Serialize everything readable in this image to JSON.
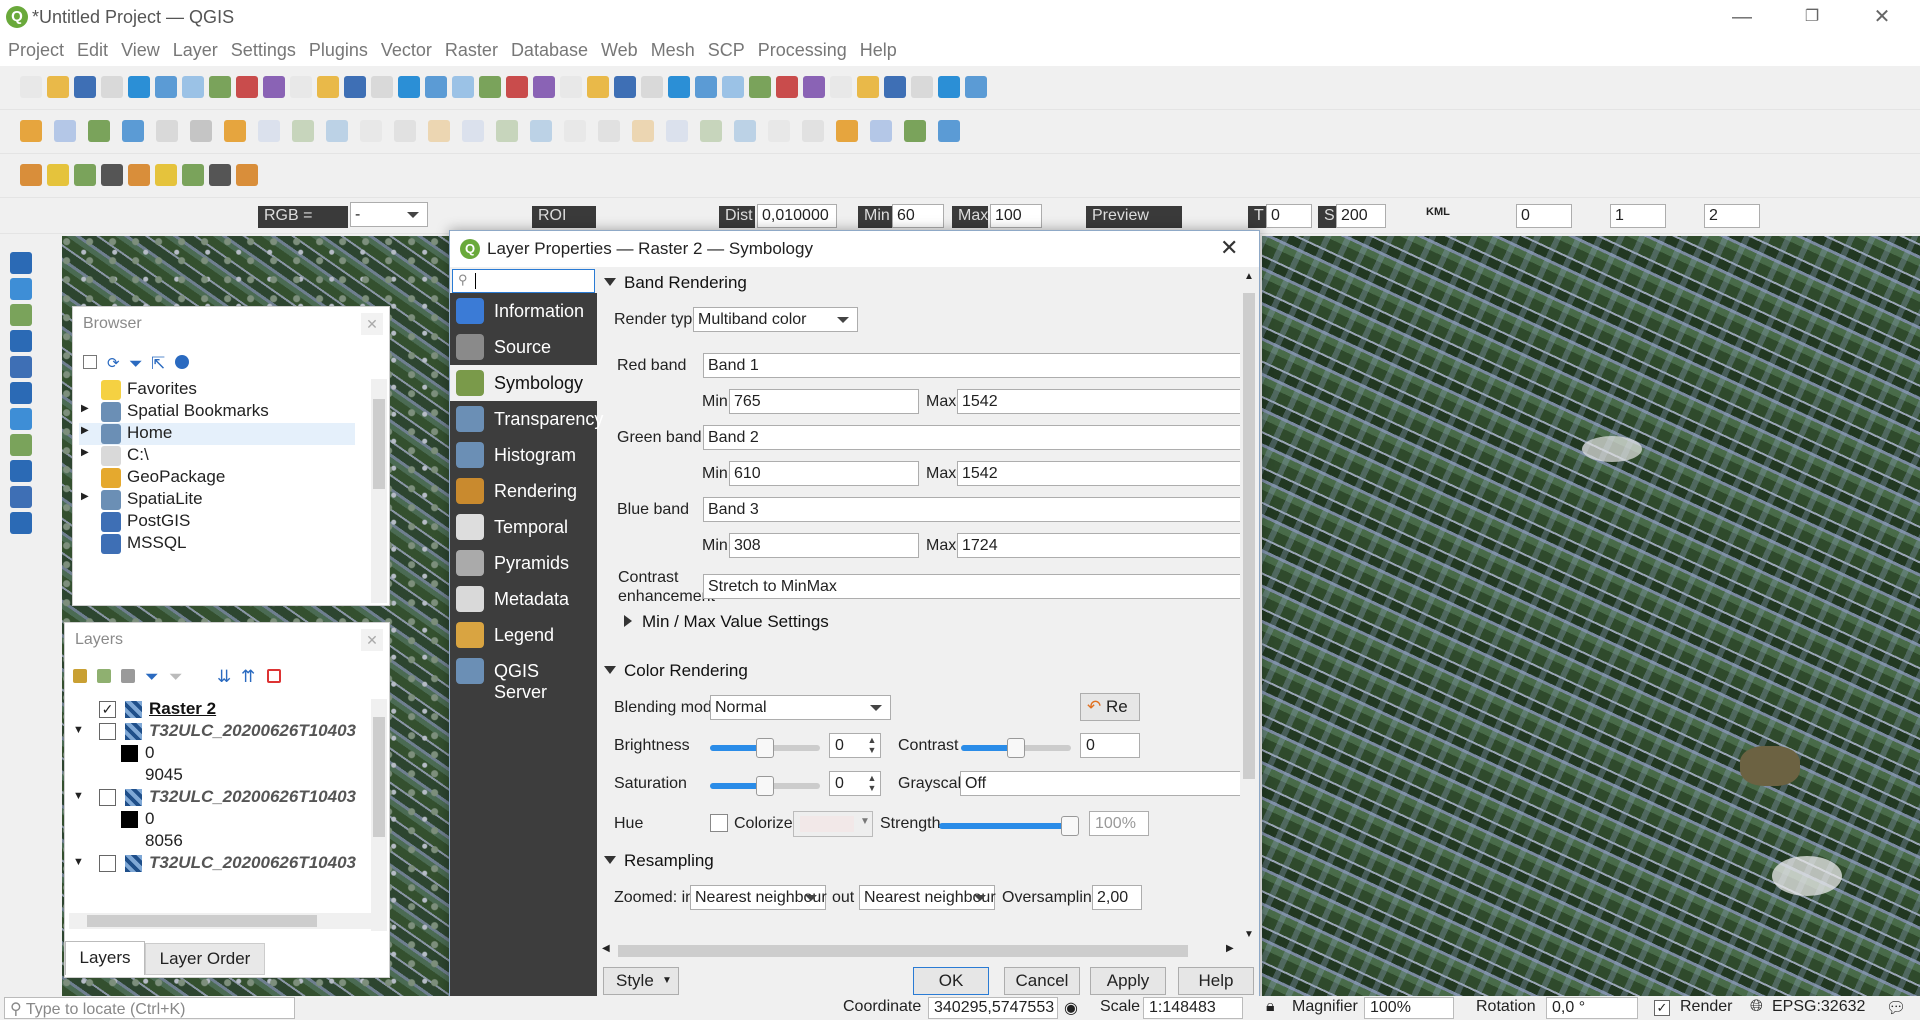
{
  "window": {
    "title": "*Untitled Project — QGIS",
    "logo": "Q"
  },
  "menu": [
    "Project",
    "Edit",
    "View",
    "Layer",
    "Settings",
    "Plugins",
    "Vector",
    "Raster",
    "Database",
    "Web",
    "Mesh",
    "SCP",
    "Processing",
    "Help"
  ],
  "scp_toolbar": {
    "rgb_label": "RGB =",
    "rgb_value": "-",
    "roi_label": "ROI",
    "dist_label": "Dist",
    "dist_value": "0,010000",
    "min_label": "Min",
    "min_value": "60",
    "max_label": "Max",
    "max_value": "100",
    "preview_label": "Preview",
    "t_label": "T",
    "t_value": "0",
    "s_label": "S",
    "s_value": "200",
    "kml_label": "KML",
    "band_a": "0",
    "band_b": "1",
    "band_c": "2"
  },
  "browser": {
    "title": "Browser",
    "items": [
      {
        "label": "Favorites",
        "icon": "star-icon",
        "expand": ""
      },
      {
        "label": "Spatial Bookmarks",
        "icon": "bookmark-icon",
        "expand": "▶"
      },
      {
        "label": "Home",
        "icon": "home-folder-icon",
        "expand": "▶"
      },
      {
        "label": "C:\\",
        "icon": "folder-icon",
        "expand": "▶"
      },
      {
        "label": "GeoPackage",
        "icon": "geopackage-icon",
        "expand": ""
      },
      {
        "label": "SpatiaLite",
        "icon": "spatialite-icon",
        "expand": "▶"
      },
      {
        "label": "PostGIS",
        "icon": "postgis-icon",
        "expand": ""
      },
      {
        "label": "MSSQL",
        "icon": "mssql-icon",
        "expand": ""
      }
    ]
  },
  "layers": {
    "title": "Layers",
    "items": [
      {
        "label": "Raster 2",
        "checked": true,
        "bold": true
      },
      {
        "label": "T32ULC_20200626T10403",
        "checked": false,
        "bold": false
      },
      {
        "label": "0",
        "legend": true
      },
      {
        "label": "9045",
        "legend": false
      },
      {
        "label": "T32ULC_20200626T10403",
        "checked": false,
        "bold": false
      },
      {
        "label": "0",
        "legend": true
      },
      {
        "label": "8056",
        "legend": false
      },
      {
        "label": "T32ULC_20200626T10403",
        "checked": false,
        "bold": false
      }
    ],
    "tabs": [
      "Layers",
      "Layer Order"
    ]
  },
  "dialog": {
    "title": "Layer Properties — Raster 2 — Symbology",
    "search_value": "",
    "nav": [
      {
        "label": "Information",
        "icon": "information-icon",
        "color": "#3b7bd6"
      },
      {
        "label": "Source",
        "icon": "source-icon",
        "color": "#8a8a8a"
      },
      {
        "label": "Symbology",
        "icon": "symbology-icon",
        "color": "#7a9a4a"
      },
      {
        "label": "Transparency",
        "icon": "transparency-icon",
        "color": "#6b8fb5"
      },
      {
        "label": "Histogram",
        "icon": "histogram-icon",
        "color": "#6b8fb5"
      },
      {
        "label": "Rendering",
        "icon": "rendering-icon",
        "color": "#c98a2e"
      },
      {
        "label": "Temporal",
        "icon": "temporal-icon",
        "color": "#dddddd"
      },
      {
        "label": "Pyramids",
        "icon": "pyramids-icon",
        "color": "#aaaaaa"
      },
      {
        "label": "Metadata",
        "icon": "metadata-icon",
        "color": "#d9d9d9"
      },
      {
        "label": "Legend",
        "icon": "legend-icon",
        "color": "#d9a441"
      },
      {
        "label": "QGIS Server",
        "icon": "qgis-server-icon",
        "color": "#6b8fb5"
      }
    ],
    "selected_nav": "Symbology",
    "band_rendering": {
      "section": "Band Rendering",
      "render_type_label": "Render type",
      "render_type": "Multiband color",
      "red_label": "Red band",
      "red_band": "Band 1",
      "red_min": "765",
      "red_max": "1542",
      "green_label": "Green band",
      "green_band": "Band 2",
      "green_min": "610",
      "green_max": "1542",
      "blue_label": "Blue band",
      "blue_band": "Band 3",
      "blue_min": "308",
      "blue_max": "1724",
      "min_label": "Min",
      "max_label": "Max",
      "contrast_label_1": "Contrast",
      "contrast_label_2": "enhancement",
      "contrast_value": "Stretch to MinMax",
      "minmax_settings": "Min / Max Value Settings"
    },
    "color_rendering": {
      "section": "Color Rendering",
      "blending_label": "Blending mode",
      "blending_value": "Normal",
      "reset_label": "Re",
      "brightness_label": "Brightness",
      "brightness_value": "0",
      "brightness_fraction": 0.5,
      "contrast_label": "Contrast",
      "contrast_value": "0",
      "contrast_fraction": 0.5,
      "saturation_label": "Saturation",
      "saturation_value": "0",
      "saturation_fraction": 0.5,
      "grayscale_label": "Grayscale",
      "grayscale_value": "Off",
      "hue_label": "Hue",
      "colorize_label": "Colorize",
      "strength_label": "Strength",
      "strength_value": "100%",
      "strength_fraction": 1.0
    },
    "resampling": {
      "section": "Resampling",
      "zoomed_in_label": "Zoomed: in",
      "zoomed_in": "Nearest neighbour",
      "out_label": "out",
      "zoomed_out": "Nearest neighbour",
      "oversampling_label": "Oversampling",
      "oversampling": "2,00"
    },
    "buttons": {
      "style": "Style",
      "ok": "OK",
      "cancel": "Cancel",
      "apply": "Apply",
      "help": "Help"
    }
  },
  "statusbar": {
    "locate_placeholder": "Type to locate (Ctrl+K)",
    "coordinate_label": "Coordinate",
    "coordinate": "340295,5747553",
    "scale_label": "Scale",
    "scale": "1:148483",
    "magnifier_label": "Magnifier",
    "magnifier": "100%",
    "rotation_label": "Rotation",
    "rotation": "0,0 °",
    "render_label": "Render",
    "crs": "EPSG:32632"
  }
}
